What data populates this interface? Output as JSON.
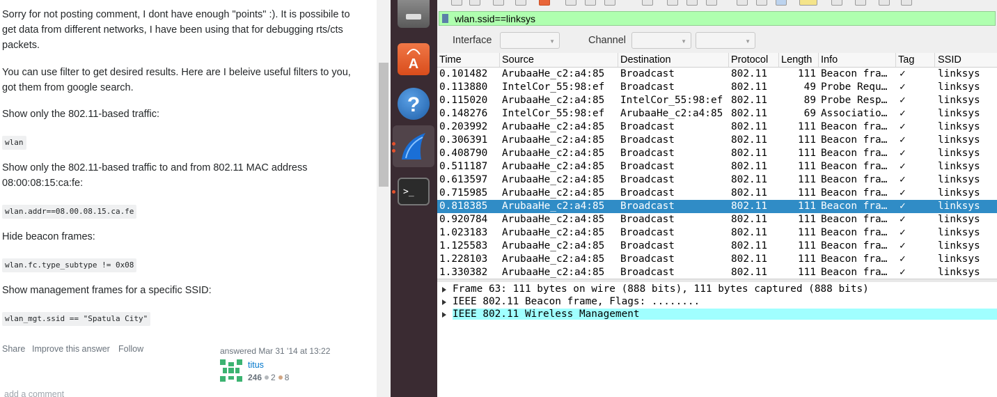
{
  "answer": {
    "p1": "Sorry for not posting comment, I dont have enough \"points\" :). It is possibile to get data from different networks, I have been using that for debugging rts/cts packets.",
    "p2": "You can use filter to get desired results. Here are I beleive useful filters to you, got them from google search.",
    "p3": "Show only the 802.11-based traffic:",
    "c1": "wlan",
    "p4": "Show only the 802.11-based traffic to and from 802.11 MAC address 08:00:08:15:ca:fe:",
    "c2": "wlan.addr==08.00.08.15.ca.fe",
    "p5": "Hide beacon frames:",
    "c3": "wlan.fc.type_subtype != 0x08",
    "p6": "Show management frames for a specific SSID:",
    "c4": "wlan_mgt.ssid == \"Spatula City\"",
    "share": "Share",
    "improve": "Improve this answer",
    "follow": "Follow",
    "answered": "answered Mar 31 '14 at 13:22",
    "user": "titus",
    "reputation": "246",
    "silver": "2",
    "bronze": "8",
    "add_comment": "add a comment"
  },
  "launcher": {
    "icons": [
      "files-icon",
      "software-center-icon",
      "help-icon",
      "wireshark-icon",
      "terminal-icon"
    ]
  },
  "wireshark": {
    "filter": "wlan.ssid==linksys",
    "interface_label": "Interface",
    "channel_label": "Channel",
    "columns": [
      "Time",
      "Source",
      "Destination",
      "Protocol",
      "Length",
      "Info",
      "Tag",
      "SSID"
    ],
    "packets": [
      [
        "0.101482",
        "ArubaaHe_c2:a4:85",
        "Broadcast",
        "802.11",
        "111",
        "Beacon fra…",
        "✓",
        "linksys"
      ],
      [
        "0.113880",
        "IntelCor_55:98:ef",
        "Broadcast",
        "802.11",
        "49",
        "Probe Requ…",
        "✓",
        "linksys"
      ],
      [
        "0.115020",
        "ArubaaHe_c2:a4:85",
        "IntelCor_55:98:ef",
        "802.11",
        "89",
        "Probe Resp…",
        "✓",
        "linksys"
      ],
      [
        "0.148276",
        "IntelCor_55:98:ef",
        "ArubaaHe_c2:a4:85",
        "802.11",
        "69",
        "Associatio…",
        "✓",
        "linksys"
      ],
      [
        "0.203992",
        "ArubaaHe_c2:a4:85",
        "Broadcast",
        "802.11",
        "111",
        "Beacon fra…",
        "✓",
        "linksys"
      ],
      [
        "0.306391",
        "ArubaaHe_c2:a4:85",
        "Broadcast",
        "802.11",
        "111",
        "Beacon fra…",
        "✓",
        "linksys"
      ],
      [
        "0.408790",
        "ArubaaHe_c2:a4:85",
        "Broadcast",
        "802.11",
        "111",
        "Beacon fra…",
        "✓",
        "linksys"
      ],
      [
        "0.511187",
        "ArubaaHe_c2:a4:85",
        "Broadcast",
        "802.11",
        "111",
        "Beacon fra…",
        "✓",
        "linksys"
      ],
      [
        "0.613597",
        "ArubaaHe_c2:a4:85",
        "Broadcast",
        "802.11",
        "111",
        "Beacon fra…",
        "✓",
        "linksys"
      ],
      [
        "0.715985",
        "ArubaaHe_c2:a4:85",
        "Broadcast",
        "802.11",
        "111",
        "Beacon fra…",
        "✓",
        "linksys"
      ],
      [
        "0.818385",
        "ArubaaHe_c2:a4:85",
        "Broadcast",
        "802.11",
        "111",
        "Beacon fra…",
        "✓",
        "linksys"
      ],
      [
        "0.920784",
        "ArubaaHe_c2:a4:85",
        "Broadcast",
        "802.11",
        "111",
        "Beacon fra…",
        "✓",
        "linksys"
      ],
      [
        "1.023183",
        "ArubaaHe_c2:a4:85",
        "Broadcast",
        "802.11",
        "111",
        "Beacon fra…",
        "✓",
        "linksys"
      ],
      [
        "1.125583",
        "ArubaaHe_c2:a4:85",
        "Broadcast",
        "802.11",
        "111",
        "Beacon fra…",
        "✓",
        "linksys"
      ],
      [
        "1.228103",
        "ArubaaHe_c2:a4:85",
        "Broadcast",
        "802.11",
        "111",
        "Beacon fra…",
        "✓",
        "linksys"
      ],
      [
        "1.330382",
        "ArubaaHe_c2:a4:85",
        "Broadcast",
        "802.11",
        "111",
        "Beacon fra…",
        "✓",
        "linksys"
      ]
    ],
    "selected_row": 10,
    "details": [
      "Frame 63: 111 bytes on wire (888 bits), 111 bytes captured (888 bits)",
      "IEEE 802.11 Beacon frame, Flags: ........",
      "IEEE 802.11 Wireless Management"
    ],
    "highlighted_detail": 2,
    "colors": {
      "filter_ok": "#afffaf",
      "selection": "#308cc6",
      "detail_highlight": "#a0ffff"
    }
  }
}
